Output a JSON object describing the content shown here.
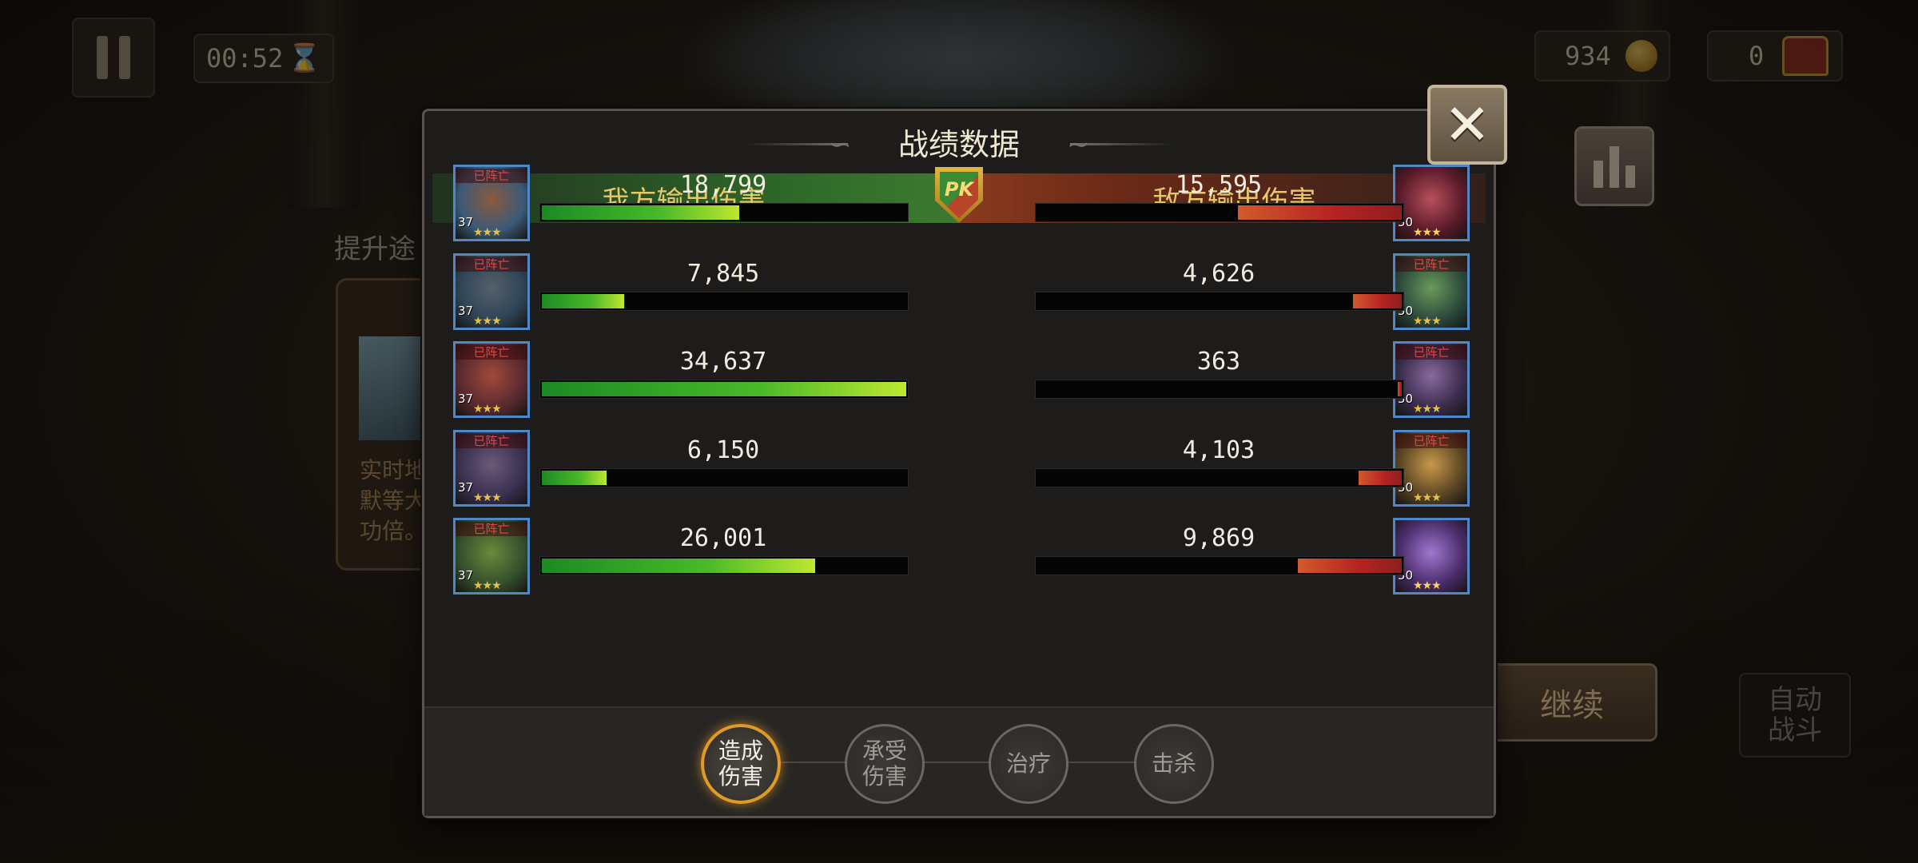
{
  "hud": {
    "timer": "00:52",
    "gold": "934",
    "chests": "0",
    "continue_label": "继续",
    "auto_battle_label": "自动战斗",
    "side_title": "提升途",
    "side_text_1": "实时地",
    "side_text_2": "默等大",
    "side_text_3": "功倍。"
  },
  "modal": {
    "title": "战绩数据",
    "ally_header": "我方输出伤害",
    "enemy_header": "敌方输出伤害",
    "pk_label": "PK",
    "close_icon": "close-icon"
  },
  "status_dead": "已阵亡",
  "max_damage": 34637,
  "rows": [
    {
      "ally": {
        "level": "37",
        "stars": "★★★",
        "dead": true,
        "damage": 18799,
        "damage_text": "18,799"
      },
      "enemy": {
        "level": "50",
        "stars": "★★★",
        "dead": false,
        "damage": 15595,
        "damage_text": "15,595"
      }
    },
    {
      "ally": {
        "level": "37",
        "stars": "★★★",
        "dead": true,
        "damage": 7845,
        "damage_text": "7,845"
      },
      "enemy": {
        "level": "50",
        "stars": "★★★",
        "dead": true,
        "damage": 4626,
        "damage_text": "4,626"
      }
    },
    {
      "ally": {
        "level": "37",
        "stars": "★★★",
        "dead": true,
        "damage": 34637,
        "damage_text": "34,637"
      },
      "enemy": {
        "level": "50",
        "stars": "★★★",
        "dead": true,
        "damage": 363,
        "damage_text": "363"
      }
    },
    {
      "ally": {
        "level": "37",
        "stars": "★★★",
        "dead": true,
        "damage": 6150,
        "damage_text": "6,150"
      },
      "enemy": {
        "level": "50",
        "stars": "★★★",
        "dead": true,
        "damage": 4103,
        "damage_text": "4,103"
      }
    },
    {
      "ally": {
        "level": "37",
        "stars": "★★★",
        "dead": true,
        "damage": 26001,
        "damage_text": "26,001"
      },
      "enemy": {
        "level": "50",
        "stars": "★★★",
        "dead": false,
        "damage": 9869,
        "damage_text": "9,869"
      }
    }
  ],
  "tabs": [
    {
      "label_1": "造成",
      "label_2": "伤害",
      "active": true
    },
    {
      "label_1": "承受",
      "label_2": "伤害",
      "active": false
    },
    {
      "label_1": "治疗",
      "label_2": "",
      "active": false
    },
    {
      "label_1": "击杀",
      "label_2": "",
      "active": false
    }
  ],
  "colors": {
    "ally_bar": "#49b928",
    "enemy_bar": "#b52222",
    "active_tab": "#e09a26",
    "portrait_border": "#4f87c7"
  }
}
